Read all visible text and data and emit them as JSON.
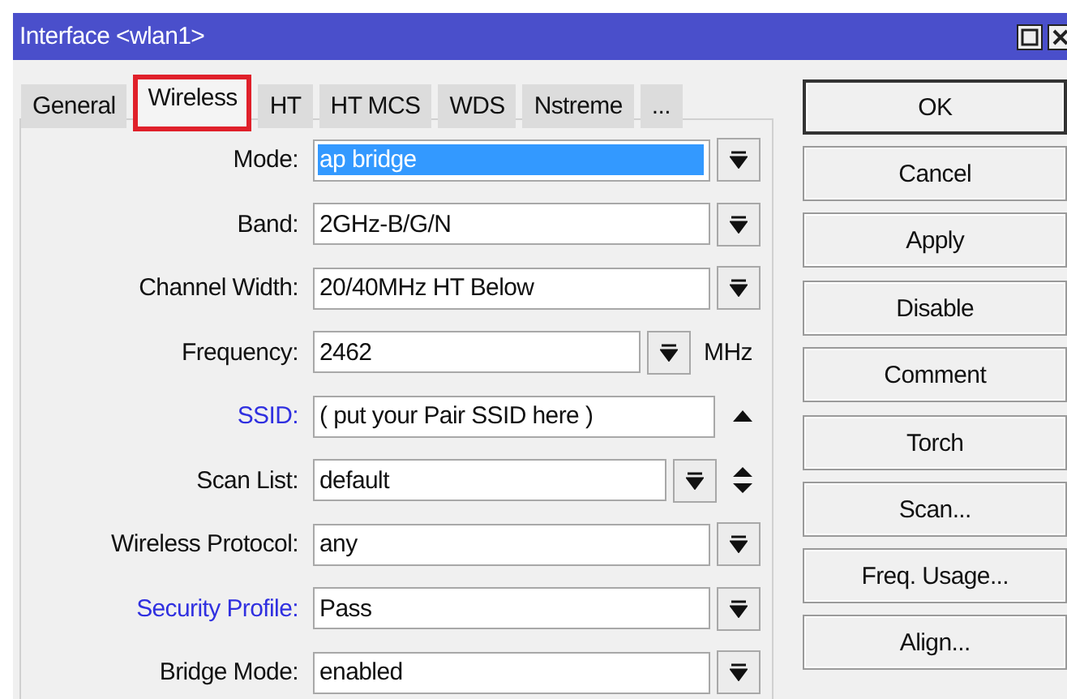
{
  "window": {
    "title": "Interface <wlan1>"
  },
  "tabs": [
    {
      "label": "General",
      "selected": false
    },
    {
      "label": "Wireless",
      "selected": true
    },
    {
      "label": "HT",
      "selected": false
    },
    {
      "label": "HT MCS",
      "selected": false
    },
    {
      "label": "WDS",
      "selected": false
    },
    {
      "label": "Nstreme",
      "selected": false
    },
    {
      "label": "...",
      "selected": false
    }
  ],
  "fields": [
    {
      "label": "Mode:",
      "value": "ap bridge",
      "kind": "dropdown",
      "linked": false,
      "highlighted": true
    },
    {
      "label": "Band:",
      "value": "2GHz-B/G/N",
      "kind": "dropdown",
      "linked": false,
      "highlighted": false
    },
    {
      "label": "Channel Width:",
      "value": "20/40MHz HT Below",
      "kind": "dropdown",
      "linked": false,
      "highlighted": false
    },
    {
      "label": "Frequency:",
      "value": "2462",
      "kind": "dropdown-unit",
      "unit": "MHz",
      "linked": false,
      "highlighted": false
    },
    {
      "label": "SSID:",
      "value": "( put your Pair SSID here )",
      "kind": "text-collapse",
      "linked": true,
      "highlighted": false
    },
    {
      "label": "Scan List:",
      "value": "default",
      "kind": "dropdown-updown",
      "linked": false,
      "highlighted": false
    },
    {
      "label": "Wireless Protocol:",
      "value": "any",
      "kind": "dropdown",
      "linked": false,
      "highlighted": false
    },
    {
      "label": "Security Profile:",
      "value": "Pass",
      "kind": "dropdown",
      "linked": true,
      "highlighted": false
    },
    {
      "label": "Bridge Mode:",
      "value": "enabled",
      "kind": "dropdown",
      "linked": false,
      "highlighted": false
    }
  ],
  "button_groups": [
    [
      "OK",
      "Cancel",
      "Apply"
    ],
    [
      "Disable",
      "Comment"
    ],
    [
      "Torch",
      "Scan...",
      "Freq. Usage...",
      "Align..."
    ]
  ]
}
